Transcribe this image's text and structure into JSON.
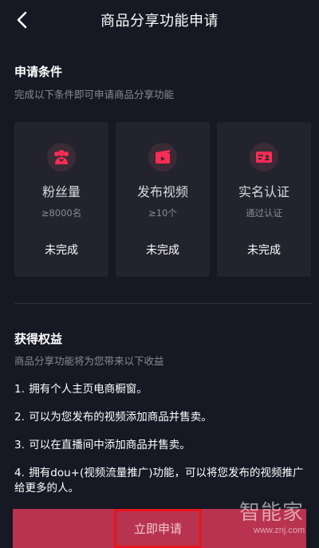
{
  "header": {
    "title": "商品分享功能申请"
  },
  "conditions": {
    "title": "申请条件",
    "subtitle": "完成以下条件即可申请商品分享功能",
    "cards": [
      {
        "icon": "fans-icon",
        "name": "粉丝量",
        "requirement": "≥8000名",
        "status": "未完成"
      },
      {
        "icon": "video-icon",
        "name": "发布视频",
        "requirement": "≥10个",
        "status": "未完成"
      },
      {
        "icon": "id-card-icon",
        "name": "实名认证",
        "requirement": "通过认证",
        "status": "未完成"
      }
    ]
  },
  "benefits": {
    "title": "获得权益",
    "subtitle": "商品分享功能将为您带来以下收益",
    "items": [
      {
        "num": "1.",
        "text": "拥有个人主页电商橱窗。"
      },
      {
        "num": "2.",
        "text": "可以为您发布的视频添加商品并售卖。"
      },
      {
        "num": "3.",
        "text": "可以在直播间中添加商品并售卖。"
      },
      {
        "num": "4.",
        "text": "拥有dou+(视频流量推广)功能，可以将您发布的视频推广给更多的人。"
      }
    ]
  },
  "apply_button": {
    "label": "立即申请"
  },
  "watermark": {
    "text": "智能家",
    "url": "www.znj.com"
  },
  "colors": {
    "background": "#161823",
    "card": "#22232d",
    "accent": "#fe2c55",
    "button": "#b8334f",
    "highlight_box": "#e8141e"
  }
}
